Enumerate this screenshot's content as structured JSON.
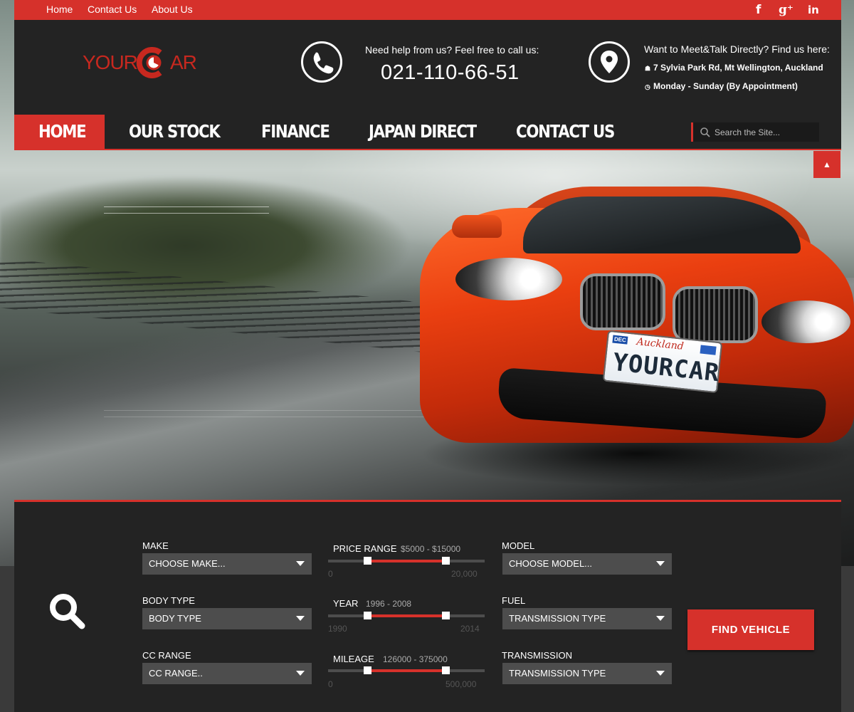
{
  "topbar": {
    "links": [
      "Home",
      "Contact Us",
      "About Us"
    ],
    "social": [
      "facebook-icon",
      "google-plus-icon",
      "linkedin-icon"
    ],
    "social_glyphs": [
      "f",
      "g⁺",
      "in"
    ]
  },
  "logo": {
    "left": "YOUR",
    "right": "AR"
  },
  "header": {
    "help_text": "Need help from us? Feel free to call us:",
    "phone": "021-110-66-51",
    "meet_text": "Want to Meet&Talk Directly? Find us here:",
    "address": "7 Sylvia Park Rd, Mt Wellington, Auckland",
    "hours": "Monday - Sunday (By Appointment)"
  },
  "nav": {
    "items": [
      "HOME",
      "OUR STOCK",
      "FINANCE",
      "JAPAN DIRECT",
      "CONTACT US"
    ],
    "active": "HOME",
    "search_placeholder": "Search the Site..."
  },
  "hero": {
    "plate_region": "Auckland",
    "plate_text": "YOURCAR",
    "plate_dec": "DEC"
  },
  "search_panel": {
    "make": {
      "label": "MAKE",
      "value": "CHOOSE MAKE..."
    },
    "body_type": {
      "label": "BODY TYPE",
      "value": "BODY TYPE"
    },
    "cc_range": {
      "label": "CC RANGE",
      "value": "CC RANGE.."
    },
    "price": {
      "label": "PRICE RANGE",
      "value": "$5000 - $15000",
      "min": "0",
      "max": "20,000",
      "low": 0.25,
      "high": 0.75
    },
    "year": {
      "label": "YEAR",
      "value": "1996 - 2008",
      "min": "1990",
      "max": "2014",
      "low": 0.25,
      "high": 0.75
    },
    "mileage": {
      "label": "MILEAGE",
      "value": "126000 - 375000",
      "min": "0",
      "max": "500,000",
      "low": 0.252,
      "high": 0.75
    },
    "model": {
      "label": "MODEL",
      "value": "CHOOSE MODEL..."
    },
    "fuel": {
      "label": "FUEL",
      "value": "TRANSMISSION TYPE"
    },
    "transmission": {
      "label": "TRANSMISSION",
      "value": "TRANSMISSION TYPE"
    },
    "find_button": "FIND VEHICLE"
  },
  "colors": {
    "accent": "#d6312b",
    "dark": "#232323",
    "field": "#4d4d4d"
  }
}
